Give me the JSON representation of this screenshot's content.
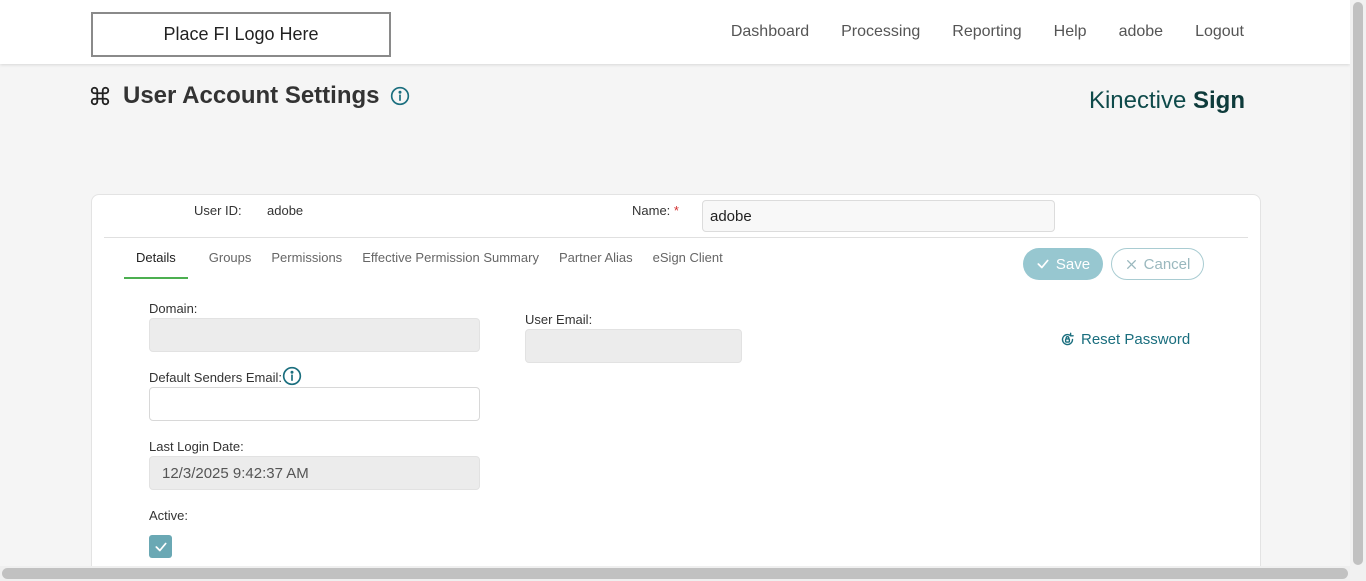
{
  "header": {
    "logo_text": "Place FI Logo Here",
    "nav": [
      "Dashboard",
      "Processing",
      "Reporting",
      "Help",
      "adobe",
      "Logout"
    ]
  },
  "page": {
    "title": "User Account Settings",
    "brand_light": "Kinective",
    "brand_bold": "Sign"
  },
  "user": {
    "id_label": "User ID:",
    "id_value": "adobe",
    "name_label": "Name:",
    "name_required_mark": "*",
    "name_value": "adobe"
  },
  "tabs": [
    "Details",
    "Groups",
    "Permissions",
    "Effective Permission Summary",
    "Partner Alias",
    "eSign Client"
  ],
  "buttons": {
    "save": "Save",
    "cancel": "Cancel",
    "reset_password": "Reset Password"
  },
  "details": {
    "domain_label": "Domain:",
    "domain_value": "",
    "user_email_label": "User Email:",
    "user_email_value": "",
    "default_senders_email_label": "Default Senders Email:",
    "default_senders_email_value": "",
    "last_login_label": "Last Login Date:",
    "last_login_value": "12/3/2025 9:42:37 AM",
    "active_label": "Active:",
    "active_checked": true
  },
  "colors": {
    "accent": "#1a6e7e",
    "tab_underline": "#4caf50",
    "save_button": "#97c7d0",
    "checkbox": "#6aa8b4",
    "required": "#d32f2f"
  }
}
